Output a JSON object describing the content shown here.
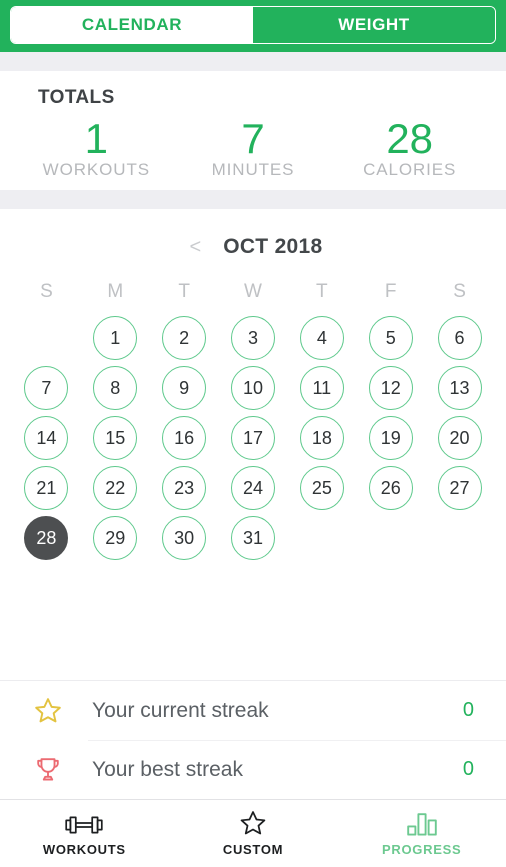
{
  "top_tabs": {
    "items": [
      {
        "label": "CALENDAR",
        "active": true
      },
      {
        "label": "WEIGHT",
        "active": false
      }
    ]
  },
  "totals": {
    "title": "TOTALS",
    "stats": [
      {
        "value": "1",
        "label": "WORKOUTS"
      },
      {
        "value": "7",
        "label": "MINUTES"
      },
      {
        "value": "28",
        "label": "CALORIES"
      }
    ]
  },
  "calendar": {
    "prev_label": "<",
    "month": "OCT 2018",
    "weekdays": [
      "S",
      "M",
      "T",
      "W",
      "T",
      "F",
      "S"
    ],
    "leading_blanks": 1,
    "days": [
      {
        "n": "1"
      },
      {
        "n": "2"
      },
      {
        "n": "3"
      },
      {
        "n": "4"
      },
      {
        "n": "5"
      },
      {
        "n": "6"
      },
      {
        "n": "7"
      },
      {
        "n": "8"
      },
      {
        "n": "9"
      },
      {
        "n": "10"
      },
      {
        "n": "11"
      },
      {
        "n": "12"
      },
      {
        "n": "13"
      },
      {
        "n": "14"
      },
      {
        "n": "15"
      },
      {
        "n": "16"
      },
      {
        "n": "17"
      },
      {
        "n": "18"
      },
      {
        "n": "19"
      },
      {
        "n": "20"
      },
      {
        "n": "21"
      },
      {
        "n": "22"
      },
      {
        "n": "23"
      },
      {
        "n": "24"
      },
      {
        "n": "25"
      },
      {
        "n": "26"
      },
      {
        "n": "27"
      },
      {
        "n": "28",
        "today": true
      },
      {
        "n": "29"
      },
      {
        "n": "30"
      },
      {
        "n": "31"
      }
    ]
  },
  "streaks": [
    {
      "icon": "star-icon",
      "label": "Your current streak",
      "value": "0"
    },
    {
      "icon": "trophy-icon",
      "label": "Your best streak",
      "value": "0"
    }
  ],
  "bottom_nav": [
    {
      "icon": "dumbbell-icon",
      "label": "WORKOUTS",
      "active": false
    },
    {
      "icon": "star-outline-icon",
      "label": "CUSTOM",
      "active": false
    },
    {
      "icon": "bar-chart-icon",
      "label": "PROGRESS",
      "active": true
    }
  ],
  "colors": {
    "brand_green": "#22b25c",
    "circle_green": "#5ec98c",
    "today_gray": "#4d4f51",
    "star_gold": "#e3c340",
    "trophy_red": "#ec6a71",
    "band_gray": "#eeeef2"
  }
}
